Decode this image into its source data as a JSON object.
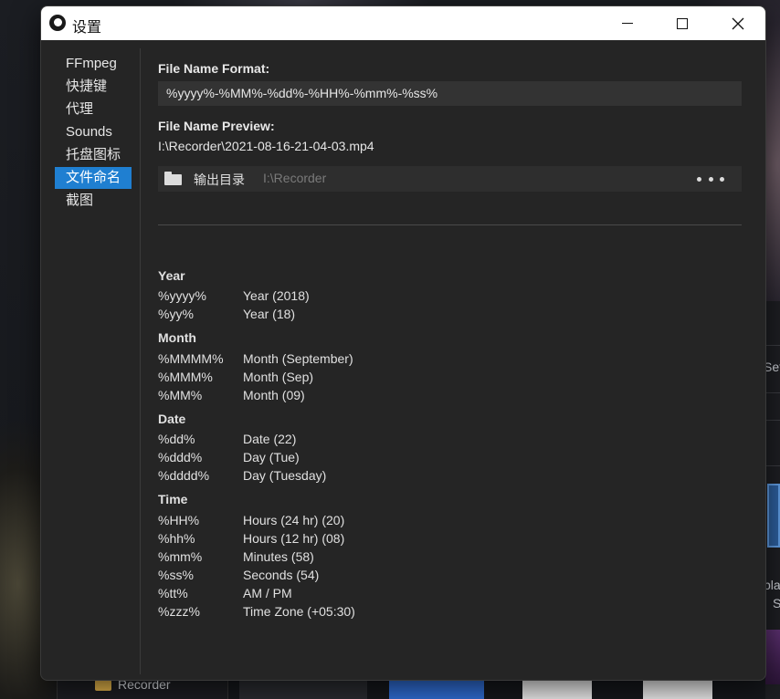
{
  "window": {
    "title": "设置",
    "controls": {
      "minimize": "minimize-icon",
      "maximize": "maximize-icon",
      "close": "close-icon"
    }
  },
  "sidebar": {
    "items": [
      {
        "label": "FFmpeg",
        "active": false
      },
      {
        "label": "快捷键",
        "active": false
      },
      {
        "label": "代理",
        "active": false
      },
      {
        "label": "Sounds",
        "active": false
      },
      {
        "label": "托盘图标",
        "active": false
      },
      {
        "label": "文件命名",
        "active": true
      },
      {
        "label": "截图",
        "active": false
      }
    ]
  },
  "file_name": {
    "format_label": "File Name Format:",
    "format_value": "%yyyy%-%MM%-%dd%-%HH%-%mm%-%ss%",
    "preview_label": "File Name Preview:",
    "preview_value": "I:\\Recorder\\2021-08-16-21-04-03.mp4"
  },
  "output_dir": {
    "label": "输出目录",
    "value": "I:\\Recorder",
    "more_icon": "more-horizontal-icon"
  },
  "legend": {
    "groups": [
      {
        "heading": "Year",
        "rows": [
          {
            "code": "%yyyy%",
            "desc": "Year (2018)"
          },
          {
            "code": "%yy%",
            "desc": "Year (18)"
          }
        ]
      },
      {
        "heading": "Month",
        "rows": [
          {
            "code": "%MMMM%",
            "desc": "Month (September)"
          },
          {
            "code": "%MMM%",
            "desc": "Month (Sep)"
          },
          {
            "code": "%MM%",
            "desc": "Month (09)"
          }
        ]
      },
      {
        "heading": "Date",
        "rows": [
          {
            "code": "%dd%",
            "desc": "Date (22)"
          },
          {
            "code": "%ddd%",
            "desc": "Day (Tue)"
          },
          {
            "code": "%dddd%",
            "desc": "Day (Tuesday)"
          }
        ]
      },
      {
        "heading": "Time",
        "rows": [
          {
            "code": "%HH%",
            "desc": "Hours (24 hr) (20)"
          },
          {
            "code": "%hh%",
            "desc": "Hours (12 hr) (08)"
          },
          {
            "code": "%mm%",
            "desc": "Minutes (58)"
          },
          {
            "code": "%ss%",
            "desc": "Seconds (54)"
          },
          {
            "code": "%tt%",
            "desc": "AM / PM"
          },
          {
            "code": "%zzz%",
            "desc": "Time Zone (+05:30)"
          }
        ]
      }
    ]
  },
  "background": {
    "folder_label": "Recorder",
    "right_edge_texts": [
      "Set",
      "pla",
      "S"
    ]
  },
  "colors": {
    "accent": "#1f7fd1",
    "window_bg": "#252525",
    "titlebar_bg": "#ffffff"
  }
}
